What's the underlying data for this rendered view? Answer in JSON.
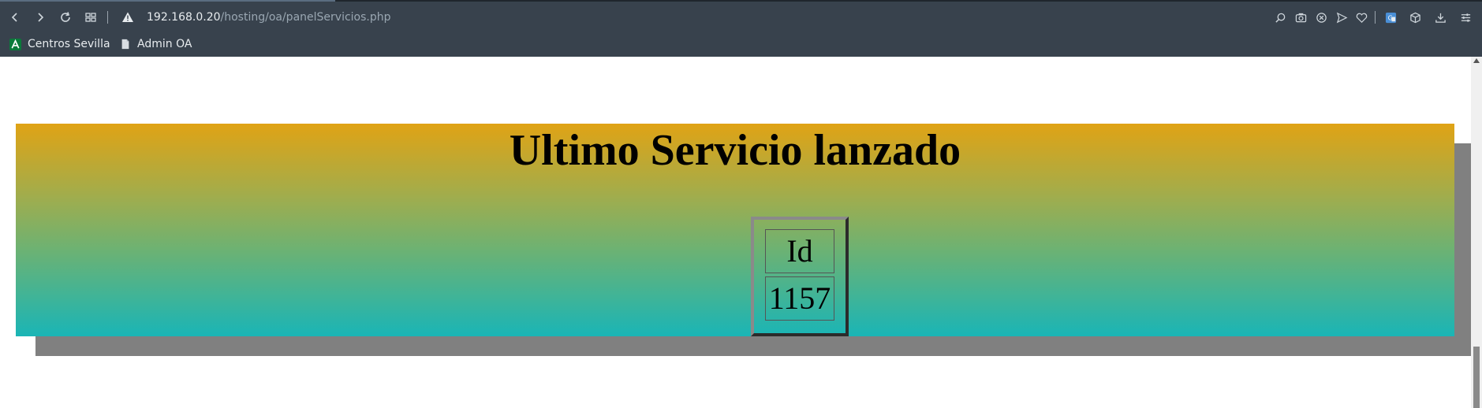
{
  "browser": {
    "url_host": "192.168.0.20",
    "url_path": "/hosting/oa/panelServicios.php",
    "bookmarks": [
      {
        "label": "Centros Sevilla",
        "icon": "andalucia-logo-icon"
      },
      {
        "label": "Admin OA",
        "icon": "document-icon"
      }
    ]
  },
  "page": {
    "title": "Ultimo Servicio lanzado",
    "table": {
      "header": "Id",
      "value": "1157"
    }
  },
  "colors": {
    "banner_top": "#e0a315",
    "banner_bottom": "#1ab5b6",
    "shadow": "#808080",
    "chrome_bg": "#38424d"
  }
}
